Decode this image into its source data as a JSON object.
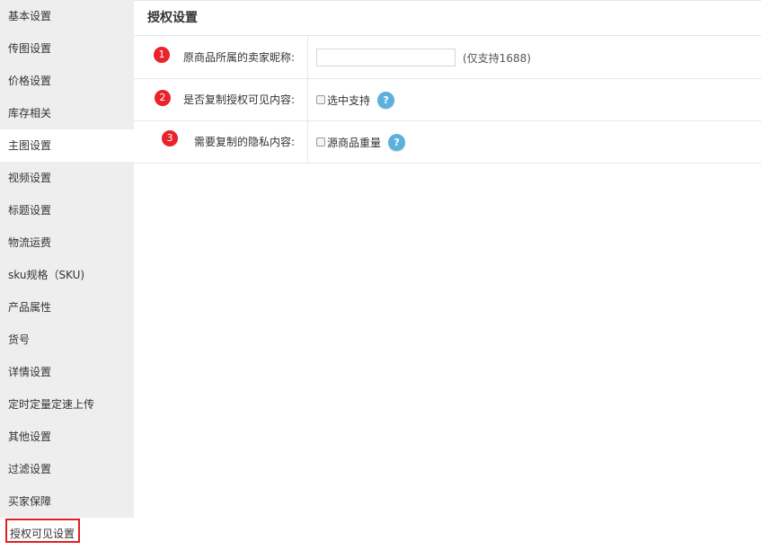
{
  "sidebar": {
    "items": [
      {
        "label": "基本设置"
      },
      {
        "label": "传图设置"
      },
      {
        "label": "价格设置"
      },
      {
        "label": "库存相关"
      },
      {
        "label": "主图设置"
      },
      {
        "label": "视频设置"
      },
      {
        "label": "标题设置"
      },
      {
        "label": "物流运费"
      },
      {
        "label": "sku规格（SKU)"
      },
      {
        "label": "产品属性"
      },
      {
        "label": "货号"
      },
      {
        "label": "详情设置"
      },
      {
        "label": "定时定量定速上传"
      },
      {
        "label": "其他设置"
      },
      {
        "label": "过滤设置"
      },
      {
        "label": "买家保障"
      },
      {
        "label": "授权可见设置"
      }
    ],
    "active_index": 4,
    "highlighted_index": 16
  },
  "main": {
    "title": "授权设置",
    "rows": [
      {
        "step": "1",
        "label": "原商品所属的卖家昵称:",
        "input_value": "",
        "input_placeholder": "",
        "hint": "(仅支持1688)"
      },
      {
        "step": "2",
        "label": "是否复制授权可见内容:",
        "checkbox_label": "选中支持",
        "checked": false,
        "help": "?"
      },
      {
        "step": "3",
        "label": "需要复制的隐私内容:",
        "checkbox_label": "源商品重量",
        "checked": false,
        "help": "?"
      }
    ]
  },
  "colors": {
    "sidebar_bg": "#eeeeee",
    "badge_red": "#e8242a",
    "highlight_border": "#e02020",
    "help_blue": "#5ab2dc"
  }
}
